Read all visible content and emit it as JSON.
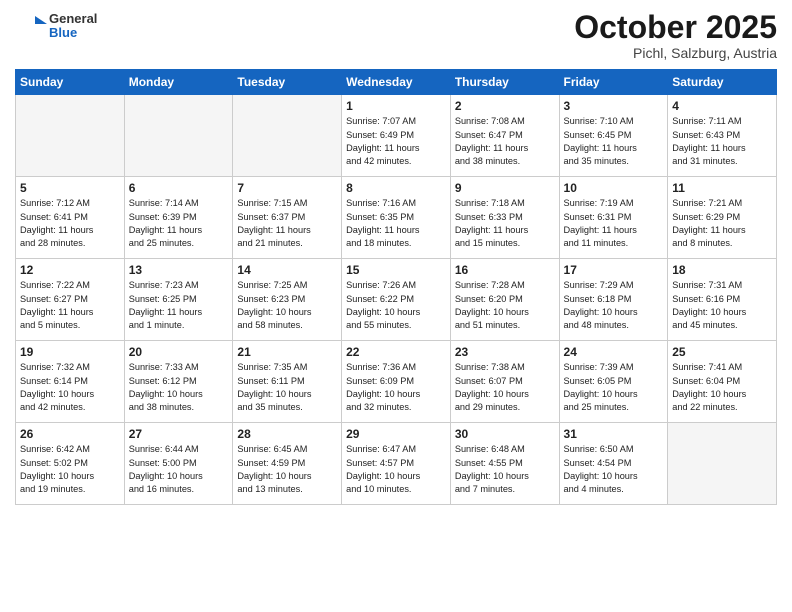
{
  "header": {
    "logo_general": "General",
    "logo_blue": "Blue",
    "month": "October 2025",
    "location": "Pichl, Salzburg, Austria"
  },
  "days_of_week": [
    "Sunday",
    "Monday",
    "Tuesday",
    "Wednesday",
    "Thursday",
    "Friday",
    "Saturday"
  ],
  "weeks": [
    [
      {
        "day": "",
        "info": ""
      },
      {
        "day": "",
        "info": ""
      },
      {
        "day": "",
        "info": ""
      },
      {
        "day": "1",
        "info": "Sunrise: 7:07 AM\nSunset: 6:49 PM\nDaylight: 11 hours\nand 42 minutes."
      },
      {
        "day": "2",
        "info": "Sunrise: 7:08 AM\nSunset: 6:47 PM\nDaylight: 11 hours\nand 38 minutes."
      },
      {
        "day": "3",
        "info": "Sunrise: 7:10 AM\nSunset: 6:45 PM\nDaylight: 11 hours\nand 35 minutes."
      },
      {
        "day": "4",
        "info": "Sunrise: 7:11 AM\nSunset: 6:43 PM\nDaylight: 11 hours\nand 31 minutes."
      }
    ],
    [
      {
        "day": "5",
        "info": "Sunrise: 7:12 AM\nSunset: 6:41 PM\nDaylight: 11 hours\nand 28 minutes."
      },
      {
        "day": "6",
        "info": "Sunrise: 7:14 AM\nSunset: 6:39 PM\nDaylight: 11 hours\nand 25 minutes."
      },
      {
        "day": "7",
        "info": "Sunrise: 7:15 AM\nSunset: 6:37 PM\nDaylight: 11 hours\nand 21 minutes."
      },
      {
        "day": "8",
        "info": "Sunrise: 7:16 AM\nSunset: 6:35 PM\nDaylight: 11 hours\nand 18 minutes."
      },
      {
        "day": "9",
        "info": "Sunrise: 7:18 AM\nSunset: 6:33 PM\nDaylight: 11 hours\nand 15 minutes."
      },
      {
        "day": "10",
        "info": "Sunrise: 7:19 AM\nSunset: 6:31 PM\nDaylight: 11 hours\nand 11 minutes."
      },
      {
        "day": "11",
        "info": "Sunrise: 7:21 AM\nSunset: 6:29 PM\nDaylight: 11 hours\nand 8 minutes."
      }
    ],
    [
      {
        "day": "12",
        "info": "Sunrise: 7:22 AM\nSunset: 6:27 PM\nDaylight: 11 hours\nand 5 minutes."
      },
      {
        "day": "13",
        "info": "Sunrise: 7:23 AM\nSunset: 6:25 PM\nDaylight: 11 hours\nand 1 minute."
      },
      {
        "day": "14",
        "info": "Sunrise: 7:25 AM\nSunset: 6:23 PM\nDaylight: 10 hours\nand 58 minutes."
      },
      {
        "day": "15",
        "info": "Sunrise: 7:26 AM\nSunset: 6:22 PM\nDaylight: 10 hours\nand 55 minutes."
      },
      {
        "day": "16",
        "info": "Sunrise: 7:28 AM\nSunset: 6:20 PM\nDaylight: 10 hours\nand 51 minutes."
      },
      {
        "day": "17",
        "info": "Sunrise: 7:29 AM\nSunset: 6:18 PM\nDaylight: 10 hours\nand 48 minutes."
      },
      {
        "day": "18",
        "info": "Sunrise: 7:31 AM\nSunset: 6:16 PM\nDaylight: 10 hours\nand 45 minutes."
      }
    ],
    [
      {
        "day": "19",
        "info": "Sunrise: 7:32 AM\nSunset: 6:14 PM\nDaylight: 10 hours\nand 42 minutes."
      },
      {
        "day": "20",
        "info": "Sunrise: 7:33 AM\nSunset: 6:12 PM\nDaylight: 10 hours\nand 38 minutes."
      },
      {
        "day": "21",
        "info": "Sunrise: 7:35 AM\nSunset: 6:11 PM\nDaylight: 10 hours\nand 35 minutes."
      },
      {
        "day": "22",
        "info": "Sunrise: 7:36 AM\nSunset: 6:09 PM\nDaylight: 10 hours\nand 32 minutes."
      },
      {
        "day": "23",
        "info": "Sunrise: 7:38 AM\nSunset: 6:07 PM\nDaylight: 10 hours\nand 29 minutes."
      },
      {
        "day": "24",
        "info": "Sunrise: 7:39 AM\nSunset: 6:05 PM\nDaylight: 10 hours\nand 25 minutes."
      },
      {
        "day": "25",
        "info": "Sunrise: 7:41 AM\nSunset: 6:04 PM\nDaylight: 10 hours\nand 22 minutes."
      }
    ],
    [
      {
        "day": "26",
        "info": "Sunrise: 6:42 AM\nSunset: 5:02 PM\nDaylight: 10 hours\nand 19 minutes."
      },
      {
        "day": "27",
        "info": "Sunrise: 6:44 AM\nSunset: 5:00 PM\nDaylight: 10 hours\nand 16 minutes."
      },
      {
        "day": "28",
        "info": "Sunrise: 6:45 AM\nSunset: 4:59 PM\nDaylight: 10 hours\nand 13 minutes."
      },
      {
        "day": "29",
        "info": "Sunrise: 6:47 AM\nSunset: 4:57 PM\nDaylight: 10 hours\nand 10 minutes."
      },
      {
        "day": "30",
        "info": "Sunrise: 6:48 AM\nSunset: 4:55 PM\nDaylight: 10 hours\nand 7 minutes."
      },
      {
        "day": "31",
        "info": "Sunrise: 6:50 AM\nSunset: 4:54 PM\nDaylight: 10 hours\nand 4 minutes."
      },
      {
        "day": "",
        "info": ""
      }
    ]
  ]
}
